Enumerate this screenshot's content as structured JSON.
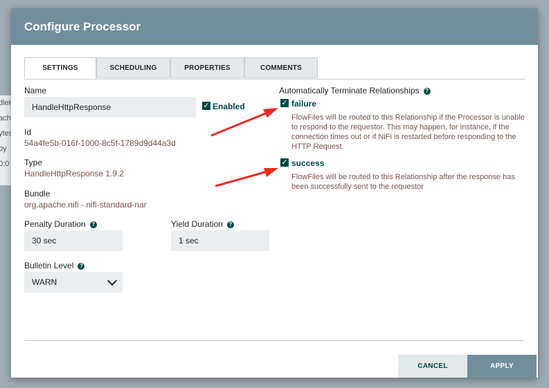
{
  "background": {
    "node_lines": [
      "dleH",
      "ache",
      "ytes",
      "by",
      "0:0"
    ]
  },
  "dialog": {
    "title": "Configure Processor"
  },
  "tabs": [
    {
      "label": "SETTINGS",
      "active": true
    },
    {
      "label": "SCHEDULING",
      "active": false
    },
    {
      "label": "PROPERTIES",
      "active": false
    },
    {
      "label": "COMMENTS",
      "active": false
    }
  ],
  "settings": {
    "name_label": "Name",
    "name_value": "HandleHttpResponse",
    "enabled_label": "Enabled",
    "enabled_checked": true,
    "id_label": "Id",
    "id_value": "54a4fe5b-016f-1000-8c5f-1789d9d44a3d",
    "type_label": "Type",
    "type_value": "HandleHttpResponse 1.9.2",
    "bundle_label": "Bundle",
    "bundle_value": "org.apache.nifi - nifi-standard-nar",
    "penalty_label": "Penalty Duration",
    "penalty_value": "30 sec",
    "yield_label": "Yield Duration",
    "yield_value": "1 sec",
    "bulletin_label": "Bulletin Level",
    "bulletin_value": "WARN"
  },
  "relationships": {
    "title": "Automatically Terminate Relationships",
    "items": [
      {
        "name": "failure",
        "checked": true,
        "description": "FlowFiles will be routed to this Relationship if the Processor is unable to respond to the requestor. This may happen, for instance, if the connection times out or if NiFi is restarted before responding to the HTTP Request."
      },
      {
        "name": "success",
        "checked": true,
        "description": "FlowFiles will be routed to this Relationship after the response has been successfully sent to the requestor"
      }
    ]
  },
  "footer": {
    "cancel_label": "CANCEL",
    "apply_label": "APPLY"
  },
  "colors": {
    "header": "#728e9b",
    "accent": "#004849",
    "value_text": "#775351",
    "annotation_arrow": "#f0291e"
  },
  "icons": {
    "help": "help-icon",
    "checkbox": "checkmark-icon",
    "dropdown": "chevron-down-icon"
  }
}
